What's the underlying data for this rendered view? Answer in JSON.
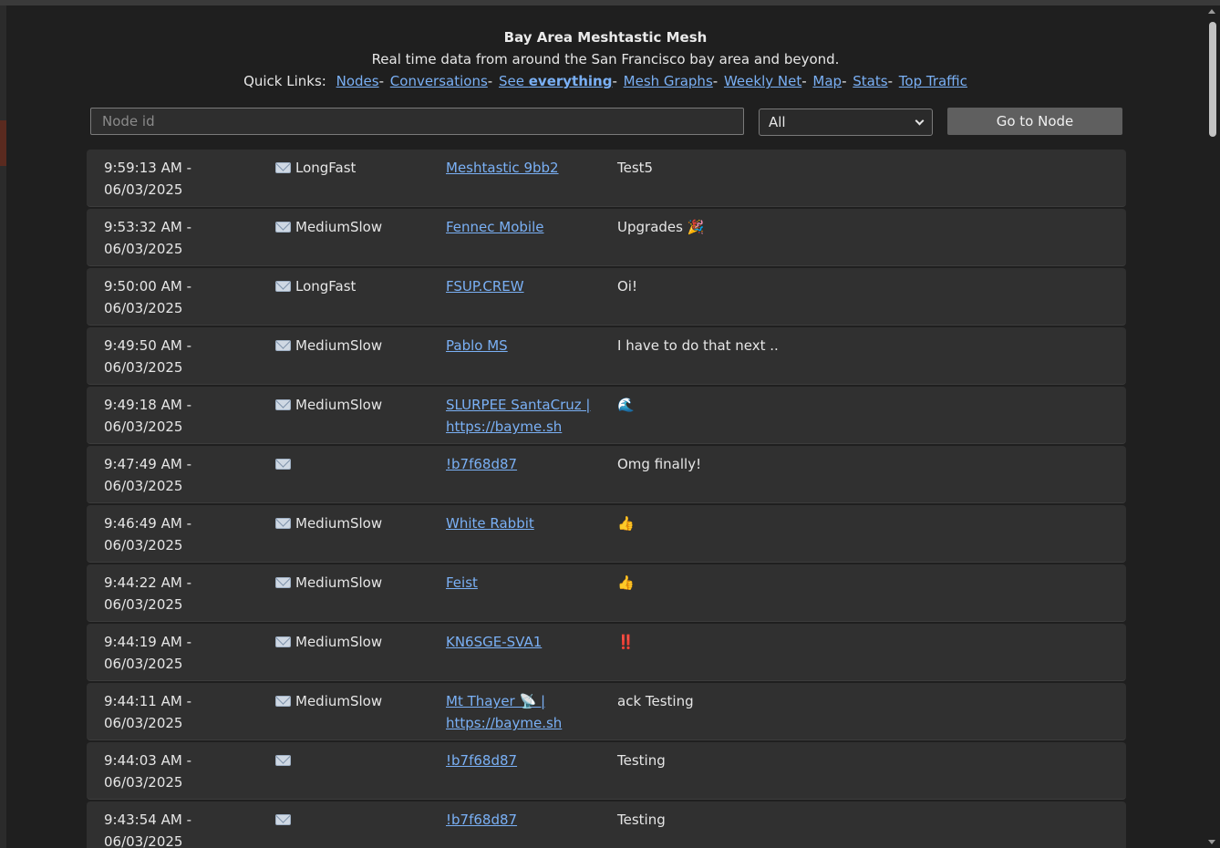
{
  "header": {
    "title": "Bay Area Meshtastic Mesh",
    "subtitle": "Real time data from around the San Francisco bay area and beyond.",
    "quick_links_label": "Quick Links:",
    "links": [
      {
        "label": "Nodes"
      },
      {
        "label": "Conversations"
      },
      {
        "label_prefix": "See ",
        "label_bold": "everything"
      },
      {
        "label": "Mesh Graphs"
      },
      {
        "label": "Weekly Net"
      },
      {
        "label": "Map"
      },
      {
        "label": "Stats"
      },
      {
        "label": "Top Traffic"
      }
    ],
    "separator": "-"
  },
  "search": {
    "placeholder": "Node id",
    "value": "",
    "channel_selected": "All",
    "go_label": "Go to Node"
  },
  "colors": {
    "background": "#1f1f1f",
    "row": "#303030",
    "link": "#7ab0f5",
    "button": "#5f5f5f"
  },
  "messages": [
    {
      "time": "9:59:13 AM -",
      "date": "06/03/2025",
      "icon": "envelope-icon",
      "channel": "LongFast",
      "from": "Meshtastic 9bb2",
      "from2": "",
      "text": "Test5"
    },
    {
      "time": "9:53:32 AM -",
      "date": "06/03/2025",
      "icon": "envelope-icon",
      "channel": "MediumSlow",
      "from": "Fennec Mobile",
      "from2": "",
      "text": "Upgrades 🎉"
    },
    {
      "time": "9:50:00 AM -",
      "date": "06/03/2025",
      "icon": "envelope-icon",
      "channel": "LongFast",
      "from": "FSUP.CREW",
      "from2": "",
      "text": "Oi!"
    },
    {
      "time": "9:49:50 AM -",
      "date": "06/03/2025",
      "icon": "envelope-icon",
      "channel": "MediumSlow",
      "from": "Pablo MS",
      "from2": "",
      "text": "I have to do that next .."
    },
    {
      "time": "9:49:18 AM -",
      "date": "06/03/2025",
      "icon": "envelope-icon",
      "channel": "MediumSlow",
      "from": "SLURPEE SantaCruz |",
      "from2": "https://bayme.sh",
      "text": "🌊"
    },
    {
      "time": "9:47:49 AM -",
      "date": "06/03/2025",
      "icon": "envelope-icon",
      "channel": "",
      "from": "!b7f68d87",
      "from2": "",
      "text": "Omg finally!"
    },
    {
      "time": "9:46:49 AM -",
      "date": "06/03/2025",
      "icon": "envelope-icon",
      "channel": "MediumSlow",
      "from": "White Rabbit",
      "from2": "",
      "text": "👍"
    },
    {
      "time": "9:44:22 AM -",
      "date": "06/03/2025",
      "icon": "envelope-icon",
      "channel": "MediumSlow",
      "from": "Feist",
      "from2": "",
      "text": "👍"
    },
    {
      "time": "9:44:19 AM -",
      "date": "06/03/2025",
      "icon": "envelope-icon",
      "channel": "MediumSlow",
      "from": "KN6SGE-SVA1",
      "from2": "",
      "text": "‼️"
    },
    {
      "time": "9:44:11 AM -",
      "date": "06/03/2025",
      "icon": "envelope-icon",
      "channel": "MediumSlow",
      "from": "Mt Thayer 📡 |",
      "from2": "https://bayme.sh",
      "text": "ack Testing"
    },
    {
      "time": "9:44:03 AM -",
      "date": "06/03/2025",
      "icon": "envelope-icon",
      "channel": "",
      "from": "!b7f68d87",
      "from2": "",
      "text": "Testing"
    },
    {
      "time": "9:43:54 AM -",
      "date": "06/03/2025",
      "icon": "envelope-icon",
      "channel": "",
      "from": "!b7f68d87",
      "from2": "",
      "text": "Testing"
    }
  ]
}
